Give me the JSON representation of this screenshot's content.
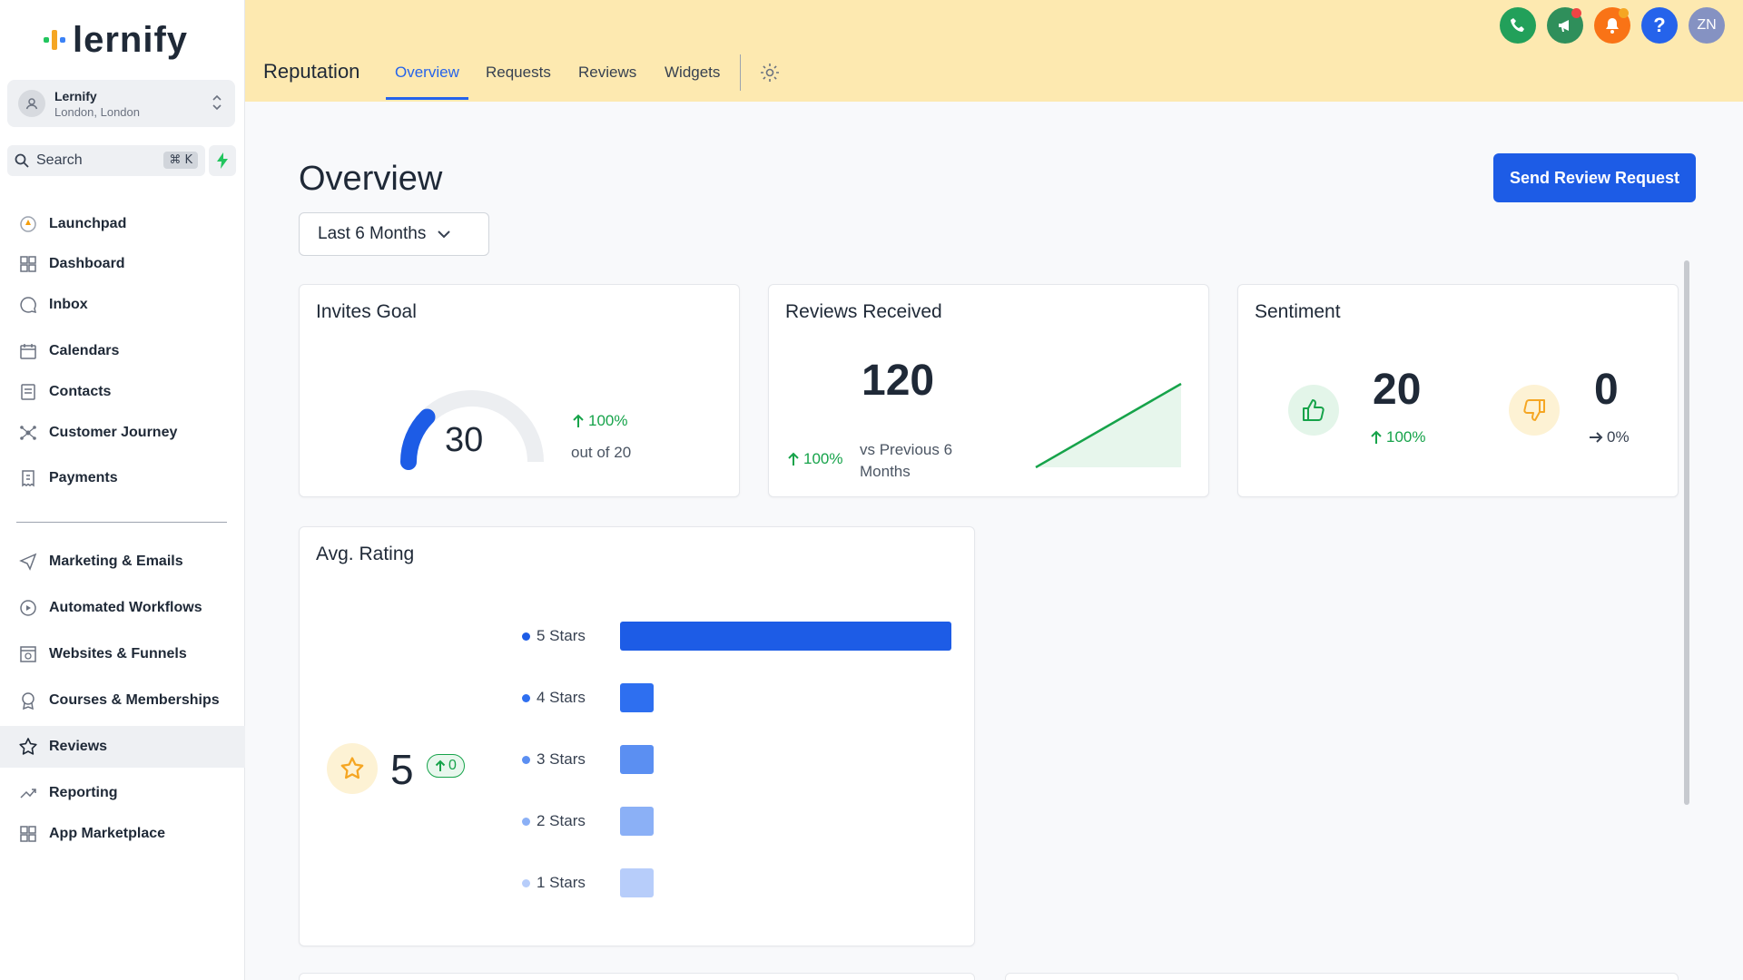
{
  "app": {
    "logo_text": "lernify",
    "account_name": "Lernify",
    "account_location": "London, London",
    "search_label": "Search",
    "search_shortcut": "⌘ K"
  },
  "sidebar": {
    "items": [
      {
        "label": "Launchpad",
        "icon": "rocket-icon"
      },
      {
        "label": "Dashboard",
        "icon": "dashboard-icon"
      },
      {
        "label": "Inbox",
        "icon": "chat-icon"
      },
      {
        "label": "Calendars",
        "icon": "calendar-icon"
      },
      {
        "label": "Contacts",
        "icon": "contacts-icon"
      },
      {
        "label": "Customer Journey",
        "icon": "journey-icon"
      },
      {
        "label": "Payments",
        "icon": "payments-icon"
      },
      {
        "label": "Marketing & Emails",
        "icon": "send-icon"
      },
      {
        "label": "Automated Workflows",
        "icon": "workflow-icon"
      },
      {
        "label": "Websites & Funnels",
        "icon": "website-icon"
      },
      {
        "label": "Courses & Memberships",
        "icon": "award-icon"
      },
      {
        "label": "Reviews",
        "icon": "star-icon",
        "active": true
      },
      {
        "label": "Reporting",
        "icon": "trend-icon"
      },
      {
        "label": "App Marketplace",
        "icon": "grid-icon"
      }
    ]
  },
  "header": {
    "module_title": "Reputation",
    "tabs": [
      "Overview",
      "Requests",
      "Reviews",
      "Widgets"
    ],
    "active_tab": "Overview",
    "user_initials": "ZN",
    "icons": [
      "phone-icon",
      "megaphone-icon",
      "bell-icon",
      "help-icon",
      "avatar"
    ]
  },
  "main": {
    "title": "Overview",
    "send_button": "Send Review Request",
    "date_range": "Last 6 Months"
  },
  "invites_goal": {
    "title": "Invites Goal",
    "value": "30",
    "change": "100%",
    "out_of": "out of 20",
    "gauge_fraction": 0.25
  },
  "reviews_received": {
    "title": "Reviews Received",
    "value": "120",
    "change": "100%",
    "compare_line1": "vs Previous 6",
    "compare_line2": "Months"
  },
  "sentiment": {
    "title": "Sentiment",
    "positive_value": "20",
    "positive_change": "100%",
    "negative_value": "0",
    "negative_change": "0%"
  },
  "avg_rating": {
    "title": "Avg. Rating",
    "value": "5",
    "change": "0",
    "rows": [
      {
        "label": "5 Stars",
        "fraction": 1.0,
        "color": "#1d5ce6"
      },
      {
        "label": "4 Stars",
        "fraction": 0.1,
        "color": "#2e6ff0"
      },
      {
        "label": "3 Stars",
        "fraction": 0.1,
        "color": "#5b8ff2"
      },
      {
        "label": "2 Stars",
        "fraction": 0.1,
        "color": "#8bb0f6"
      },
      {
        "label": "1 Stars",
        "fraction": 0.1,
        "color": "#b7cdfa"
      }
    ]
  },
  "colors": {
    "topbar": "#fde9b0",
    "accent": "#1d5ce6",
    "positive": "#16a34a",
    "warning": "#f5a623"
  }
}
